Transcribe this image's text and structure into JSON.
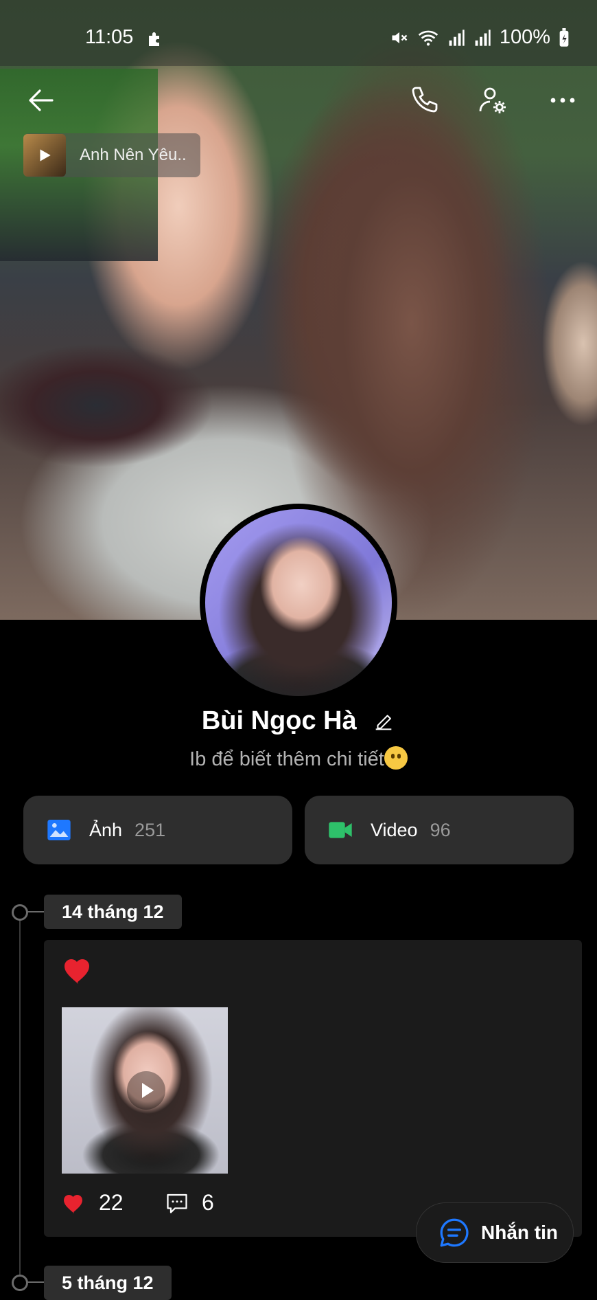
{
  "status_bar": {
    "time": "11:05",
    "battery": "100%",
    "icons": [
      "puzzle-icon",
      "mute-icon",
      "wifi-icon",
      "signal-icon",
      "signal-icon",
      "battery-icon"
    ]
  },
  "top_bar": {
    "icons": [
      "back-arrow-icon",
      "phone-icon",
      "user-settings-icon",
      "more-icon"
    ]
  },
  "music": {
    "title": "Anh Nên Yêu.."
  },
  "profile": {
    "name": "Bùi Ngọc Hà",
    "bio": "Ib để biết thêm chi tiết"
  },
  "media": {
    "photos": {
      "label": "Ảnh",
      "count": "251",
      "color": "#1e78ff"
    },
    "videos": {
      "label": "Video",
      "count": "96",
      "color": "#2ec16a"
    }
  },
  "timeline": {
    "posts": [
      {
        "date": "14 tháng 12",
        "likes": "22",
        "comments": "6"
      }
    ],
    "next_date": "5 tháng 12"
  },
  "fab": {
    "label": "Nhắn tin"
  },
  "colors": {
    "heart": "#e8232f",
    "accent_blue": "#1e78ff",
    "bg": "#000000"
  }
}
